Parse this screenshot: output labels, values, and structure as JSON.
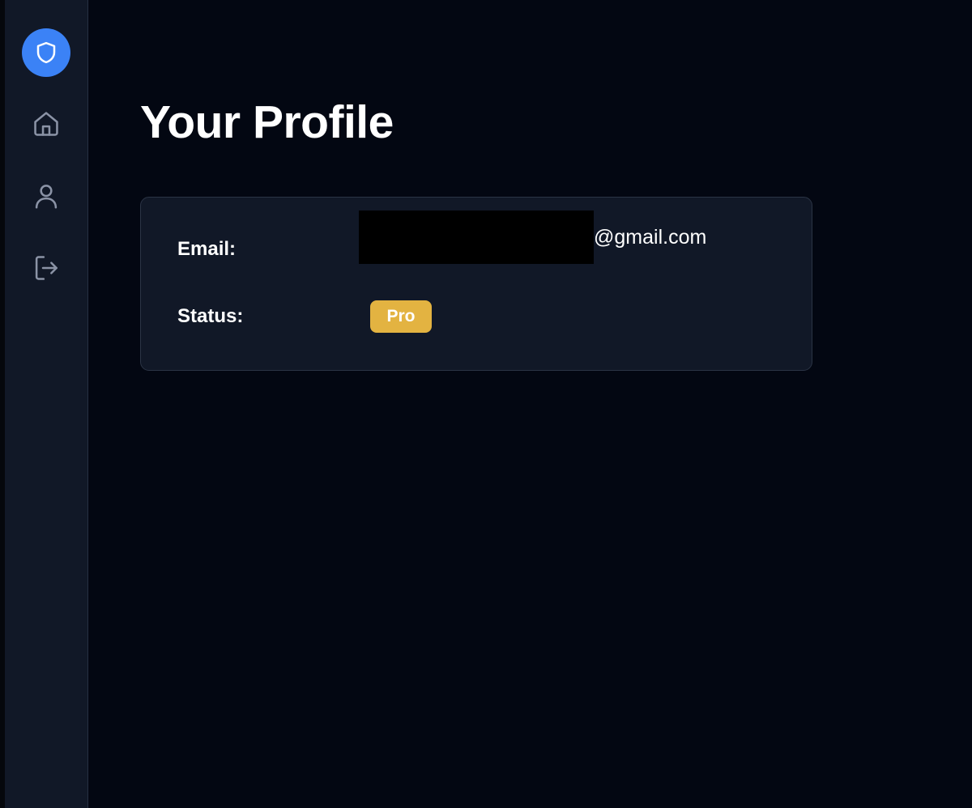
{
  "sidebar": {
    "logo_icon": "shield-icon",
    "logo_color": "#3b82f6",
    "items": [
      {
        "icon": "home-icon",
        "name": "home"
      },
      {
        "icon": "user-icon",
        "name": "profile"
      },
      {
        "icon": "logout-icon",
        "name": "logout"
      }
    ]
  },
  "main": {
    "title": "Your Profile",
    "profile": {
      "email_label": "Email:",
      "email_domain": "@gmail.com",
      "status_label": "Status:",
      "status_value": "Pro",
      "status_color": "#e3b341"
    }
  }
}
